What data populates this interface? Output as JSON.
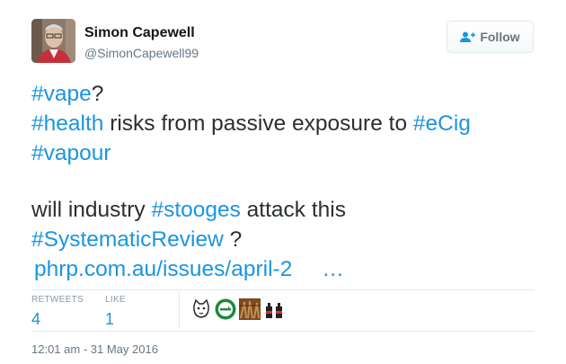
{
  "user": {
    "name": "Simon Capewell",
    "handle": "@SimonCapewell99"
  },
  "follow_button": {
    "label": "Follow"
  },
  "tweet": {
    "line1": [
      {
        "text": "#vape",
        "hashtag": true
      },
      {
        "text": "?",
        "hashtag": false
      }
    ],
    "line2": [
      {
        "text": "#health",
        "hashtag": true
      },
      {
        "text": " risks from passive exposure to ",
        "hashtag": false
      },
      {
        "text": "#eCig",
        "hashtag": true
      }
    ],
    "line3": [
      {
        "text": "#vapour",
        "hashtag": true
      }
    ],
    "line4": [
      {
        "text": "will industry ",
        "hashtag": false
      },
      {
        "text": "#stooges",
        "hashtag": true
      },
      {
        "text": " attack this",
        "hashtag": false
      }
    ],
    "line5": [
      {
        "text": "#SystematicReview",
        "hashtag": true
      },
      {
        "text": " ?",
        "hashtag": false
      }
    ],
    "link": "phrp.com.au/issues/april-2",
    "ellipsis": "…"
  },
  "stats": {
    "retweets_label": "RETWEETS",
    "retweets": "4",
    "likes_label": "LIKE",
    "likes": "1"
  },
  "likers": [
    "cat-avatar",
    "green-badge-avatar",
    "brown-pattern-avatar",
    "bottles-avatar"
  ],
  "timestamp": "12:01 am - 31 May 2016",
  "colors": {
    "link": "#1b95e0",
    "text": "#292f33",
    "muted": "#657786"
  }
}
